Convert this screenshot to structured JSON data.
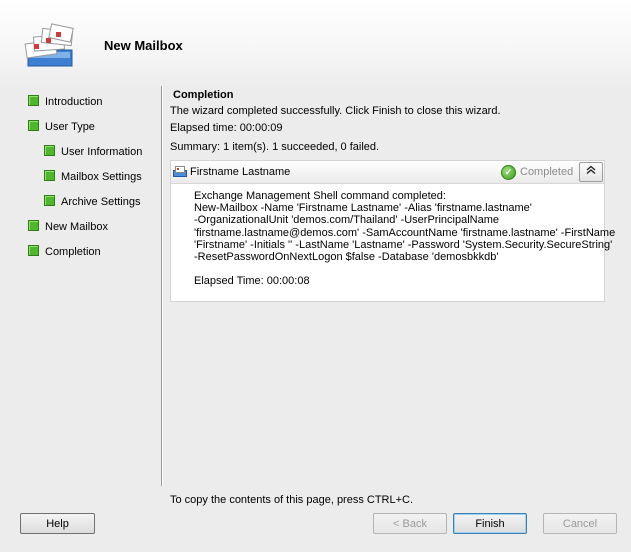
{
  "wizard": {
    "title": "New Mailbox",
    "icon": "mailbox-stack-icon"
  },
  "nav": {
    "items": [
      {
        "label": "Introduction",
        "indent": false
      },
      {
        "label": "User Type",
        "indent": false
      },
      {
        "label": "User Information",
        "indent": true
      },
      {
        "label": "Mailbox Settings",
        "indent": true
      },
      {
        "label": "Archive Settings",
        "indent": true
      },
      {
        "label": "New Mailbox",
        "indent": false
      },
      {
        "label": "Completion",
        "indent": false
      }
    ],
    "status_color": "#4fb62d"
  },
  "page": {
    "title": "Completion",
    "message": "The wizard completed successfully. Click Finish to close this wizard.",
    "elapsed": "Elapsed time: 00:00:09",
    "summary": "Summary: 1 item(s). 1 succeeded, 0 failed."
  },
  "result": {
    "name": "Firstname Lastname",
    "status": "Completed",
    "status_icon": "check-circle-icon",
    "collapse_icon": "double-chevron-up-icon",
    "lines": [
      "Exchange Management Shell command completed:",
      "New-Mailbox -Name 'Firstname Lastname' -Alias 'firstname.lastname'",
      "-OrganizationalUnit 'demos.com/Thailand' -UserPrincipalName",
      "'firstname.lastname@demos.com' -SamAccountName 'firstname.lastname' -FirstName",
      "'Firstname' -Initials '' -LastName 'Lastname' -Password 'System.Security.SecureString'",
      "-ResetPasswordOnNextLogon $false -Database 'demosbkkdb'",
      "",
      "Elapsed Time: 00:00:08"
    ]
  },
  "footer": {
    "copy_hint": "To copy the contents of this page, press CTRL+C.",
    "help_label": "Help",
    "back_label": "< Back",
    "finish_label": "Finish",
    "cancel_label": "Cancel"
  }
}
